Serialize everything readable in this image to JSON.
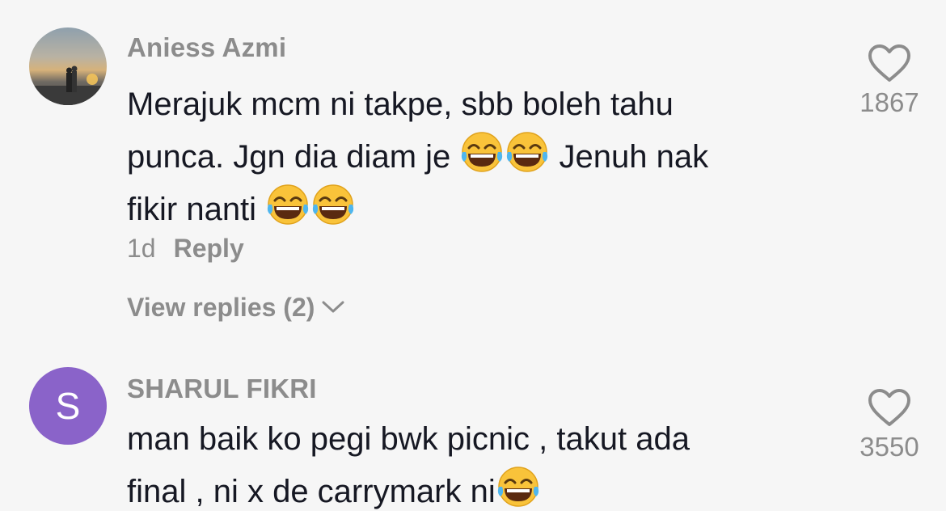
{
  "comments": [
    {
      "username": "Aniess Azmi",
      "text_lines": [
        {
          "segments": [
            "Merajuk mcm ni takpe, sbb boleh tahu"
          ]
        },
        {
          "segments": [
            "punca. Jgn dia diam je ",
            " Jenuh nak"
          ],
          "emojis_after": [
            0
          ],
          "emoji_count": 2
        },
        {
          "segments": [
            "fikir nanti "
          ],
          "emoji_count": 2
        }
      ],
      "line1": "Merajuk mcm ni takpe, sbb boleh tahu",
      "line2a": "punca. Jgn dia diam je ",
      "line2b": " Jenuh nak",
      "line3": "fikir nanti ",
      "emoji": "face-with-tears-of-joy",
      "time": "1d",
      "reply_label": "Reply",
      "view_replies": "View replies (2)",
      "likes": "1867",
      "avatar": "photo-couple-sunset"
    },
    {
      "username": "SHARUL FIKRI",
      "line1": "man baik ko pegi bwk picnic , takut ada",
      "line2": "final , ni x de carrymark ni",
      "emoji": "face-with-tears-of-joy",
      "likes": "3550",
      "avatar_letter": "S",
      "avatar_color": "#8a63c9"
    }
  ],
  "colors": {
    "background": "#f6f6f6",
    "text": "#161823",
    "muted": "#8c8c8c"
  },
  "icons": [
    "heart-outline-icon",
    "chevron-down-icon",
    "face-with-tears-of-joy-emoji"
  ]
}
